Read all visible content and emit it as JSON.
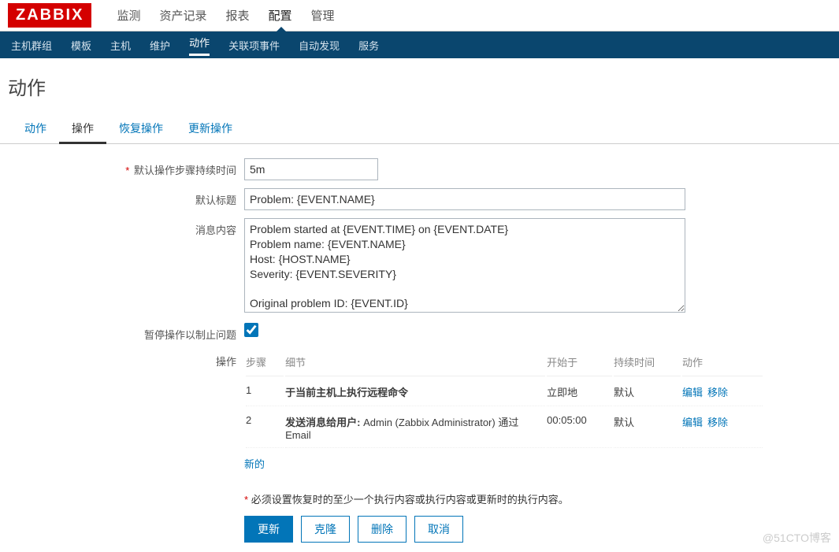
{
  "logo": "ZABBIX",
  "topnav": {
    "items": [
      "监测",
      "资产记录",
      "报表",
      "配置",
      "管理"
    ],
    "activeIndex": 3
  },
  "subnav": {
    "items": [
      "主机群组",
      "模板",
      "主机",
      "维护",
      "动作",
      "关联项事件",
      "自动发现",
      "服务"
    ],
    "activeIndex": 4
  },
  "page_title": "动作",
  "form_tabs": {
    "items": [
      "动作",
      "操作",
      "恢复操作",
      "更新操作"
    ],
    "activeIndex": 1
  },
  "labels": {
    "duration": "默认操作步骤持续时间",
    "subject": "默认标题",
    "message": "消息内容",
    "pause": "暂停操作以制止问题",
    "operations": "操作"
  },
  "fields": {
    "duration": "5m",
    "subject": "Problem: {EVENT.NAME}",
    "message": "Problem started at {EVENT.TIME} on {EVENT.DATE}\nProblem name: {EVENT.NAME}\nHost: {HOST.NAME}\nSeverity: {EVENT.SEVERITY}\n\nOriginal problem ID: {EVENT.ID}\n{TRIGGER.URL}",
    "pause_checked": true
  },
  "ops_table": {
    "headers": {
      "step": "步骤",
      "detail": "细节",
      "start": "开始于",
      "duration": "持续时间",
      "action": "动作"
    },
    "rows": [
      {
        "step": "1",
        "detail_bold": "于当前主机上执行远程命令",
        "detail_rest": "",
        "start": "立即地",
        "duration": "默认"
      },
      {
        "step": "2",
        "detail_bold": "发送消息给用户:",
        "detail_rest": " Admin (Zabbix Administrator) 通过 Email",
        "start": "00:05:00",
        "duration": "默认"
      }
    ],
    "row_actions": {
      "edit": "编辑",
      "remove": "移除"
    },
    "new_label": "新的"
  },
  "hint": "必须设置恢复时的至少一个执行内容或执行内容或更新时的执行内容。",
  "buttons": {
    "update": "更新",
    "clone": "克隆",
    "delete": "删除",
    "cancel": "取消"
  },
  "watermark": "@51CTO博客"
}
